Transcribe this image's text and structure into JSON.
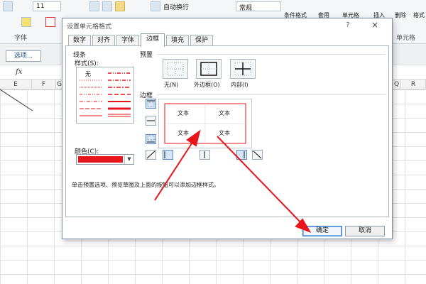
{
  "ribbon": {
    "font_size_value": "11",
    "wrap_text_label": "自动换行",
    "number_format_value": "常规",
    "group_font_label": "字体",
    "cell_style_label": "条件格式",
    "apply_label": "套用",
    "cell_label": "单元格",
    "insert_label": "插入",
    "delete_label": "删除",
    "format_label": "格式",
    "cells_group_label": "单元格"
  },
  "options_button": "选项...",
  "formula_bar": {
    "fx": "fx"
  },
  "columns": [
    "E",
    "F",
    "G",
    "Q",
    "R"
  ],
  "dialog": {
    "title": "设置单元格格式",
    "help": "?",
    "close": "×",
    "tabs": [
      {
        "label": "数字",
        "active": false
      },
      {
        "label": "对齐",
        "active": false
      },
      {
        "label": "字体",
        "active": false
      },
      {
        "label": "边框",
        "active": true
      },
      {
        "label": "填充",
        "active": false
      },
      {
        "label": "保护",
        "active": false
      }
    ],
    "line": {
      "section_title": "线条",
      "style_label": "样式(S):",
      "none_label": "无",
      "color_label": "颜色(C):",
      "color_value": "#e8141b"
    },
    "preset": {
      "section_title": "预置",
      "none": "无(N)",
      "outline": "外边框(O)",
      "inside": "内部(I)"
    },
    "border": {
      "section_title": "边框",
      "preview_texts": [
        "文本",
        "文本",
        "文本",
        "文本"
      ]
    },
    "hint": "单击预置选项、预览草图及上面的按钮可以添加边框样式。",
    "ok_label": "确定",
    "cancel_label": "取消"
  },
  "colors": {
    "accent_red": "#e8141b",
    "dialog_border": "#7a8ca0",
    "selected_blue": "#3c7fd0"
  }
}
